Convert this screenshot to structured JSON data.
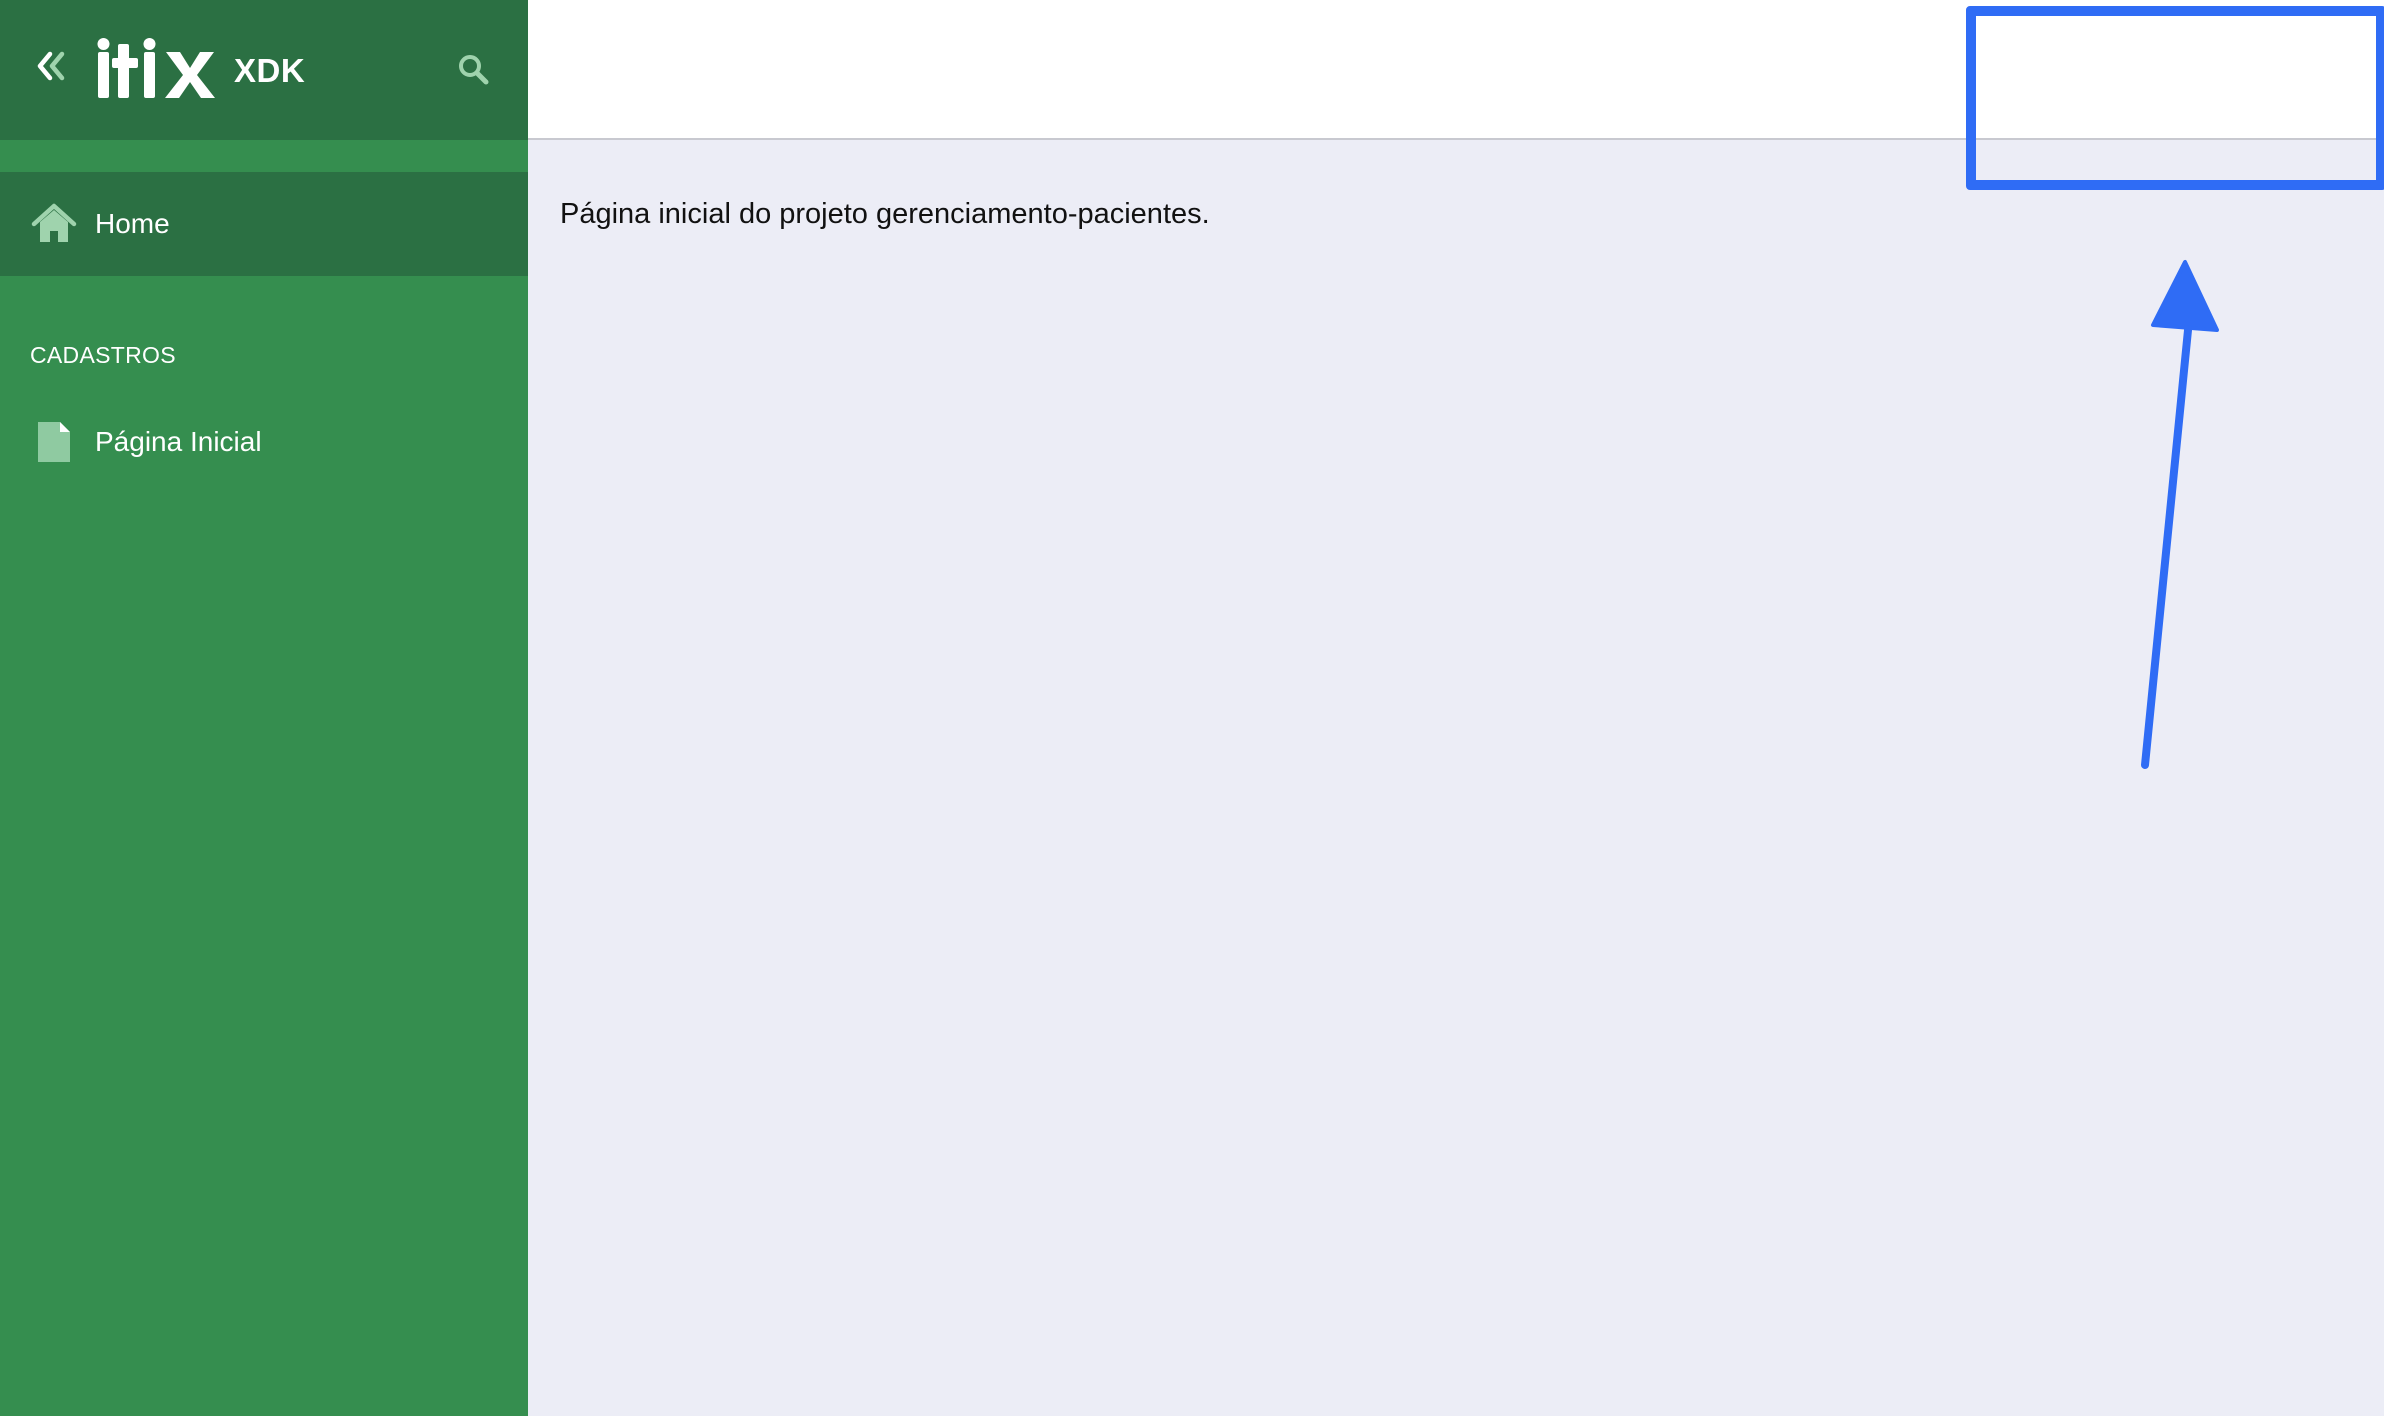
{
  "sidebar": {
    "logo_text": "itix",
    "logo_suffix": "XDK",
    "collapse_icon": "double-chevron-left-icon",
    "search_icon": "search-icon",
    "items": [
      {
        "label": "Home",
        "icon": "home-icon",
        "active": true
      }
    ],
    "sections": [
      {
        "title": "CADASTROS",
        "items": [
          {
            "label": "Página Inicial",
            "icon": "file-icon"
          }
        ]
      }
    ]
  },
  "main": {
    "welcome_text": "Página inicial do projeto gerenciamento-pacientes."
  },
  "colors": {
    "sidebar_bg": "#358e4f",
    "sidebar_dark": "#2b7043",
    "content_bg": "#ecedf6",
    "annotation_blue": "#2f6cf5"
  }
}
